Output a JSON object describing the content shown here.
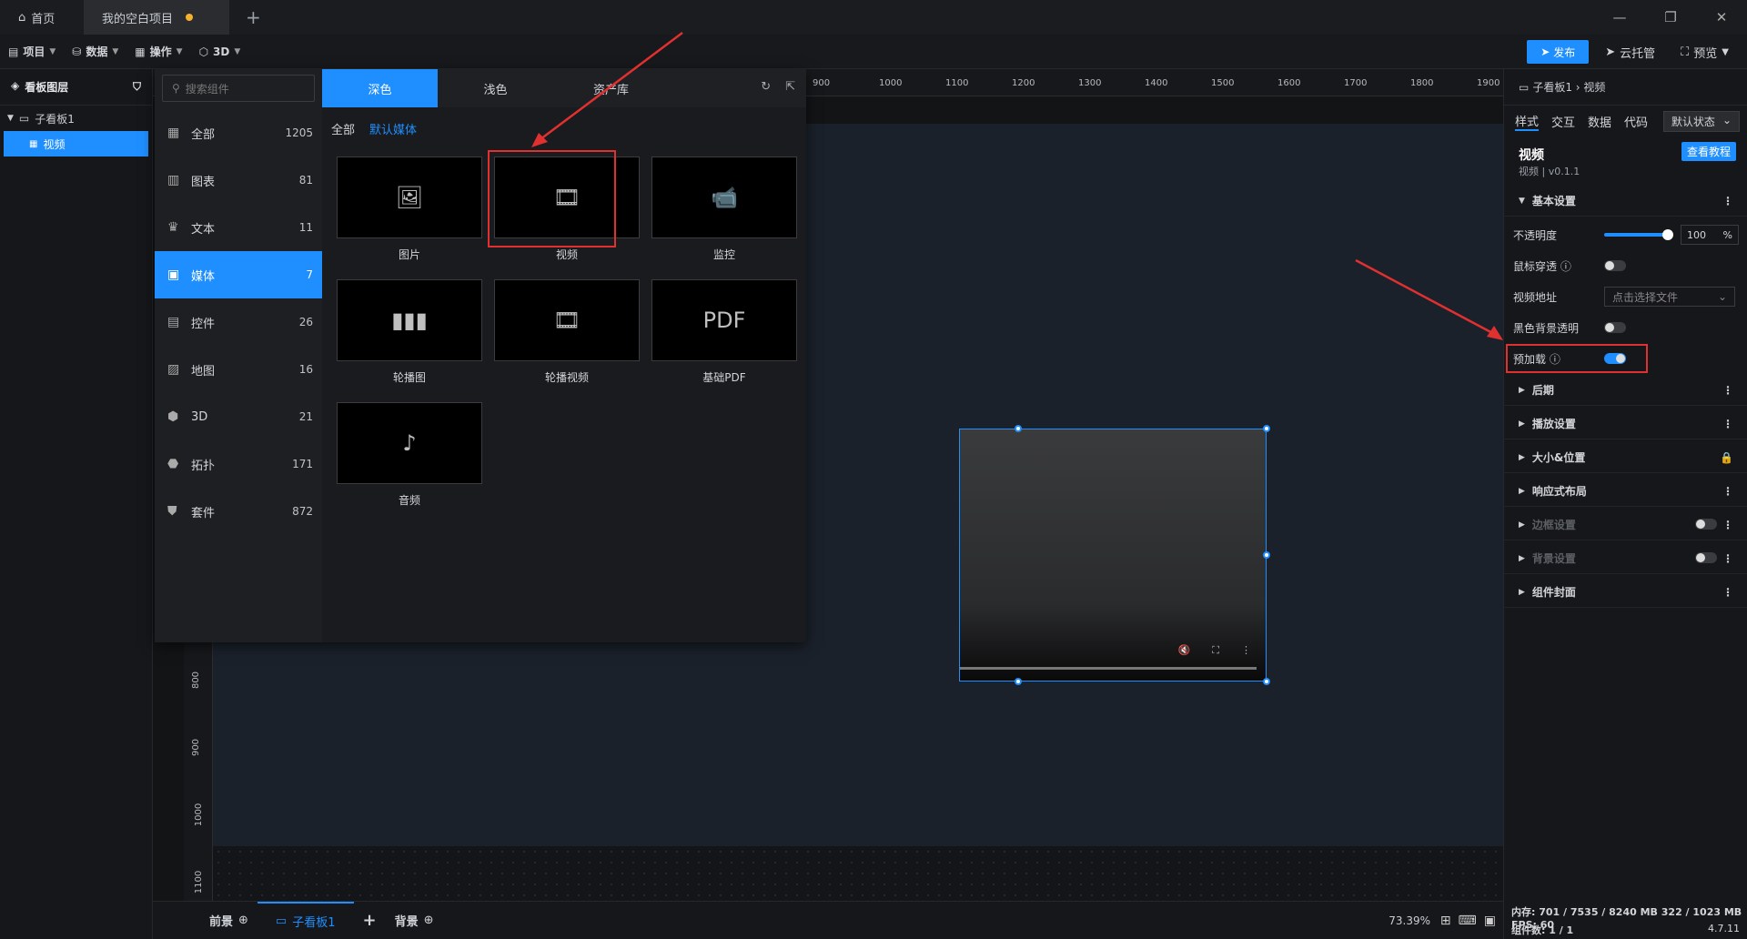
{
  "titlebar": {
    "home_tab": "首页",
    "project_tab": "我的空白项目",
    "new_tab": "+",
    "window_controls": [
      "—",
      "❐",
      "✕"
    ]
  },
  "toolbar": {
    "menus": [
      "项目",
      "数据",
      "操作",
      "3D"
    ],
    "publish": "发布",
    "cloud": "云托管",
    "preview": "预览"
  },
  "layers": {
    "title": "看板图层",
    "board": "子看板1",
    "item": "视频"
  },
  "ruler": {
    "h_ticks": [
      "900",
      "1000",
      "1100",
      "1200",
      "1300",
      "1400",
      "1500",
      "1600",
      "1700",
      "1800",
      "1900"
    ],
    "v_ticks": [
      "800",
      "900",
      "1000",
      "1100"
    ]
  },
  "component_panel": {
    "search_placeholder": "搜索组件",
    "categories": [
      {
        "label": "全部",
        "count": "1205",
        "icon": "grid-icon"
      },
      {
        "label": "图表",
        "count": "81",
        "icon": "chart-icon"
      },
      {
        "label": "文本",
        "count": "11",
        "icon": "text-icon"
      },
      {
        "label": "媒体",
        "count": "7",
        "icon": "media-icon"
      },
      {
        "label": "控件",
        "count": "26",
        "icon": "control-icon"
      },
      {
        "label": "地图",
        "count": "16",
        "icon": "map-icon"
      },
      {
        "label": "3D",
        "count": "21",
        "icon": "cube-icon"
      },
      {
        "label": "拓扑",
        "count": "171",
        "icon": "topology-icon"
      },
      {
        "label": "套件",
        "count": "872",
        "icon": "suite-icon"
      }
    ],
    "tabs": [
      "深色",
      "浅色",
      "资产库"
    ],
    "filters": [
      "全部",
      "默认媒体"
    ],
    "cards": [
      {
        "label": "图片",
        "glyph": "🖼"
      },
      {
        "label": "视频",
        "glyph": "🎞"
      },
      {
        "label": "监控",
        "glyph": "📹"
      },
      {
        "label": "轮播图",
        "glyph": "▮▮▮"
      },
      {
        "label": "轮播视频",
        "glyph": "🎞"
      },
      {
        "label": "基础PDF",
        "glyph": "PDF"
      },
      {
        "label": "音频",
        "glyph": "♪"
      }
    ]
  },
  "bottombar": {
    "front": "前景",
    "board_tab": "子看板1",
    "add": "+",
    "back": "背景",
    "zoom": "73.39%"
  },
  "right_panel": {
    "breadcrumb": "子看板1 › 视频",
    "tabs": [
      "样式",
      "交互",
      "数据",
      "代码"
    ],
    "state_select": "默认状态",
    "component_title": "视频",
    "component_sub": "视频 | v0.1.1",
    "tutorial": "查看教程",
    "basic_section": "基本设置",
    "opacity_label": "不透明度",
    "opacity_value": "100",
    "opacity_unit": "%",
    "mouse_through_label": "鼠标穿透",
    "video_url_label": "视频地址",
    "video_url_placeholder": "点击选择文件",
    "black_bg_label": "黑色背景透明",
    "preload_label": "预加载",
    "sections": [
      "后期",
      "播放设置",
      "大小&位置",
      "响应式布局",
      "边框设置",
      "背景设置",
      "组件封面"
    ],
    "mem_stat": "内存: 701 / 7535 / 8240 MB 322 / 1023 MB FPS: 60",
    "count_stat": "组件数: 1 / 1",
    "version": "4.7.11"
  }
}
